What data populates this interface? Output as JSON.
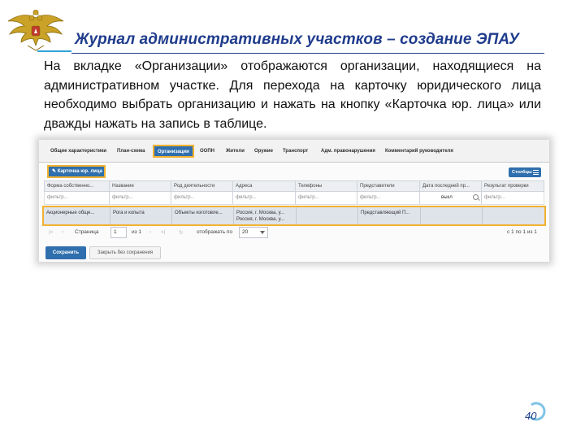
{
  "header": {
    "title": "Журнал административных участков – создание ЭПАУ"
  },
  "description": "На вкладке «Организации» отображаются организации, находящиеся на административном участке. Для перехода на карточку юридического лица необходимо выбрать организацию и нажать на кнопку «Карточка юр. лица» или дважды нажать на запись в таблице.",
  "tabs": [
    {
      "label": "Общие характеристики"
    },
    {
      "label": "План-схема"
    },
    {
      "label": "Организации"
    },
    {
      "label": "ООПН"
    },
    {
      "label": "Жители"
    },
    {
      "label": "Оружие"
    },
    {
      "label": "Транспорт"
    },
    {
      "label": "Адм. правонарушения"
    },
    {
      "label": "Комментарий руководителя"
    }
  ],
  "toolbar": {
    "card_button": "Карточка юр. лица",
    "columns_button": "Столбцы"
  },
  "table": {
    "columns": [
      "Форма собственно...",
      "Название",
      "Род деятельности",
      "Адреса",
      "Телефоны",
      "Представители",
      "Дата последней пр...",
      "Результат проверки"
    ],
    "filters": [
      "фильтр...",
      "фильтр...",
      "фильтр...",
      "фильтр...",
      "фильтр...",
      "фильтр...",
      "выкл",
      "фильтр..."
    ],
    "row": {
      "ownership": "Акционерные обще...",
      "name": "Рога и копыта",
      "activity": "Объекты изготовле...",
      "address_1": "Россия, г. Москва, у...",
      "address_2": "Россия, г. Москва, у...",
      "phones": "",
      "representatives": "Представляющий П...",
      "last_check": "",
      "result": ""
    }
  },
  "pager": {
    "page_label": "Страница",
    "page_value": "1",
    "of_label": "из 1",
    "show_label": "отображать по",
    "page_size": "20",
    "range_text": "с 1 по 1 из 1"
  },
  "footer_buttons": {
    "save": "Сохранить",
    "close": "Закрыть без сохранения"
  },
  "page_number": "40",
  "colors": {
    "title": "#1f3c8c",
    "accent_blue": "#2f6fad",
    "highlight": "#f2b230",
    "rule_light": "#2fa6d8"
  }
}
